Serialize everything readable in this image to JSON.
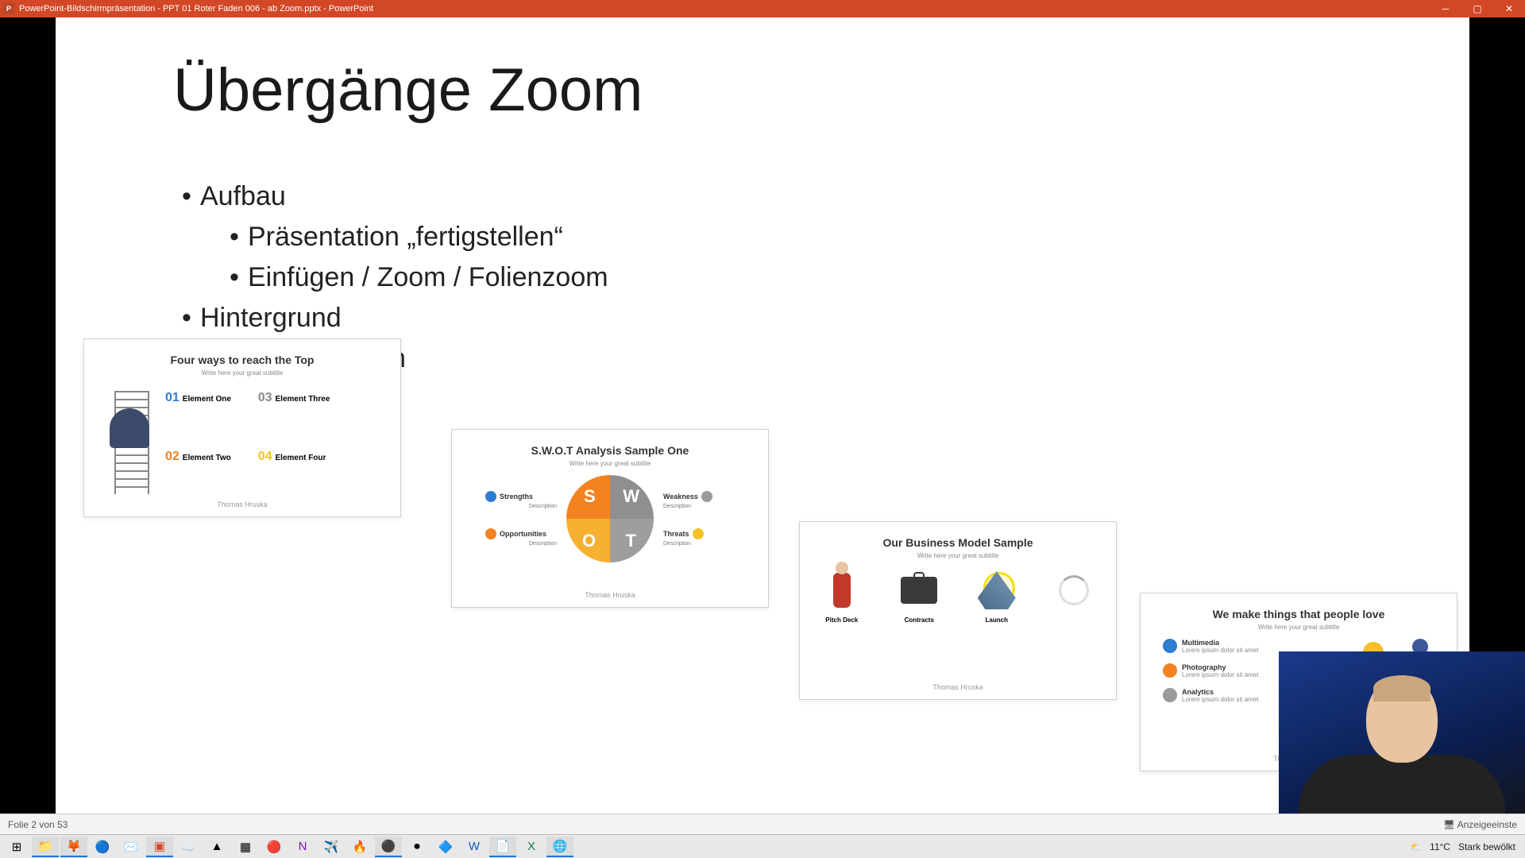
{
  "titlebar": {
    "app_icon_letter": "P",
    "title": "PowerPoint-Bildschirmpräsentation  -  PPT 01 Roter Faden 006 - ab Zoom.pptx - PowerPoint"
  },
  "slide": {
    "title": "Übergänge Zoom",
    "bullets": {
      "b1": "Aufbau",
      "b1a": "Präsentation „fertigstellen“",
      "b1b": "Einfügen / Zoom / Folienzoom",
      "b2": "Hintergrund",
      "b3": "Bild austauschen"
    }
  },
  "thumbs": {
    "t1": {
      "title": "Four ways to reach the Top",
      "sub": "Write here your great subtitle",
      "e1_num": "01",
      "e1_label": "Element One",
      "e2_num": "02",
      "e2_label": "Element Two",
      "e3_num": "03",
      "e3_label": "Element Three",
      "e4_num": "04",
      "e4_label": "Element Four",
      "footer": "Thomas Hruska"
    },
    "t2": {
      "title": "S.W.O.T Analysis Sample One",
      "sub": "Write here your great subtitle",
      "s": "S",
      "w": "W",
      "o": "O",
      "t": "T",
      "strengths": "Strengths",
      "weakness": "Weakness",
      "opportunities": "Opportunities",
      "threats": "Threats",
      "desc": "Description",
      "footer": "Thomas Hruska"
    },
    "t3": {
      "title": "Our Business Model Sample",
      "sub": "Write here your great subtitle",
      "i1": "Pitch Deck",
      "i2": "Contracts",
      "i3": "Launch",
      "footer": "Thomas Hruska"
    },
    "t4": {
      "title": "We make things that people love",
      "sub": "Write here your great subtitle",
      "l1": "Multimedia",
      "l2": "Photography",
      "l3": "Analytics",
      "footer": "Thomas Hruska"
    }
  },
  "statusbar": {
    "left": "Folie 2 von 53",
    "right": "Anzeigeeinste"
  },
  "system": {
    "temp": "11°C",
    "weather": "Stark bewölkt"
  }
}
